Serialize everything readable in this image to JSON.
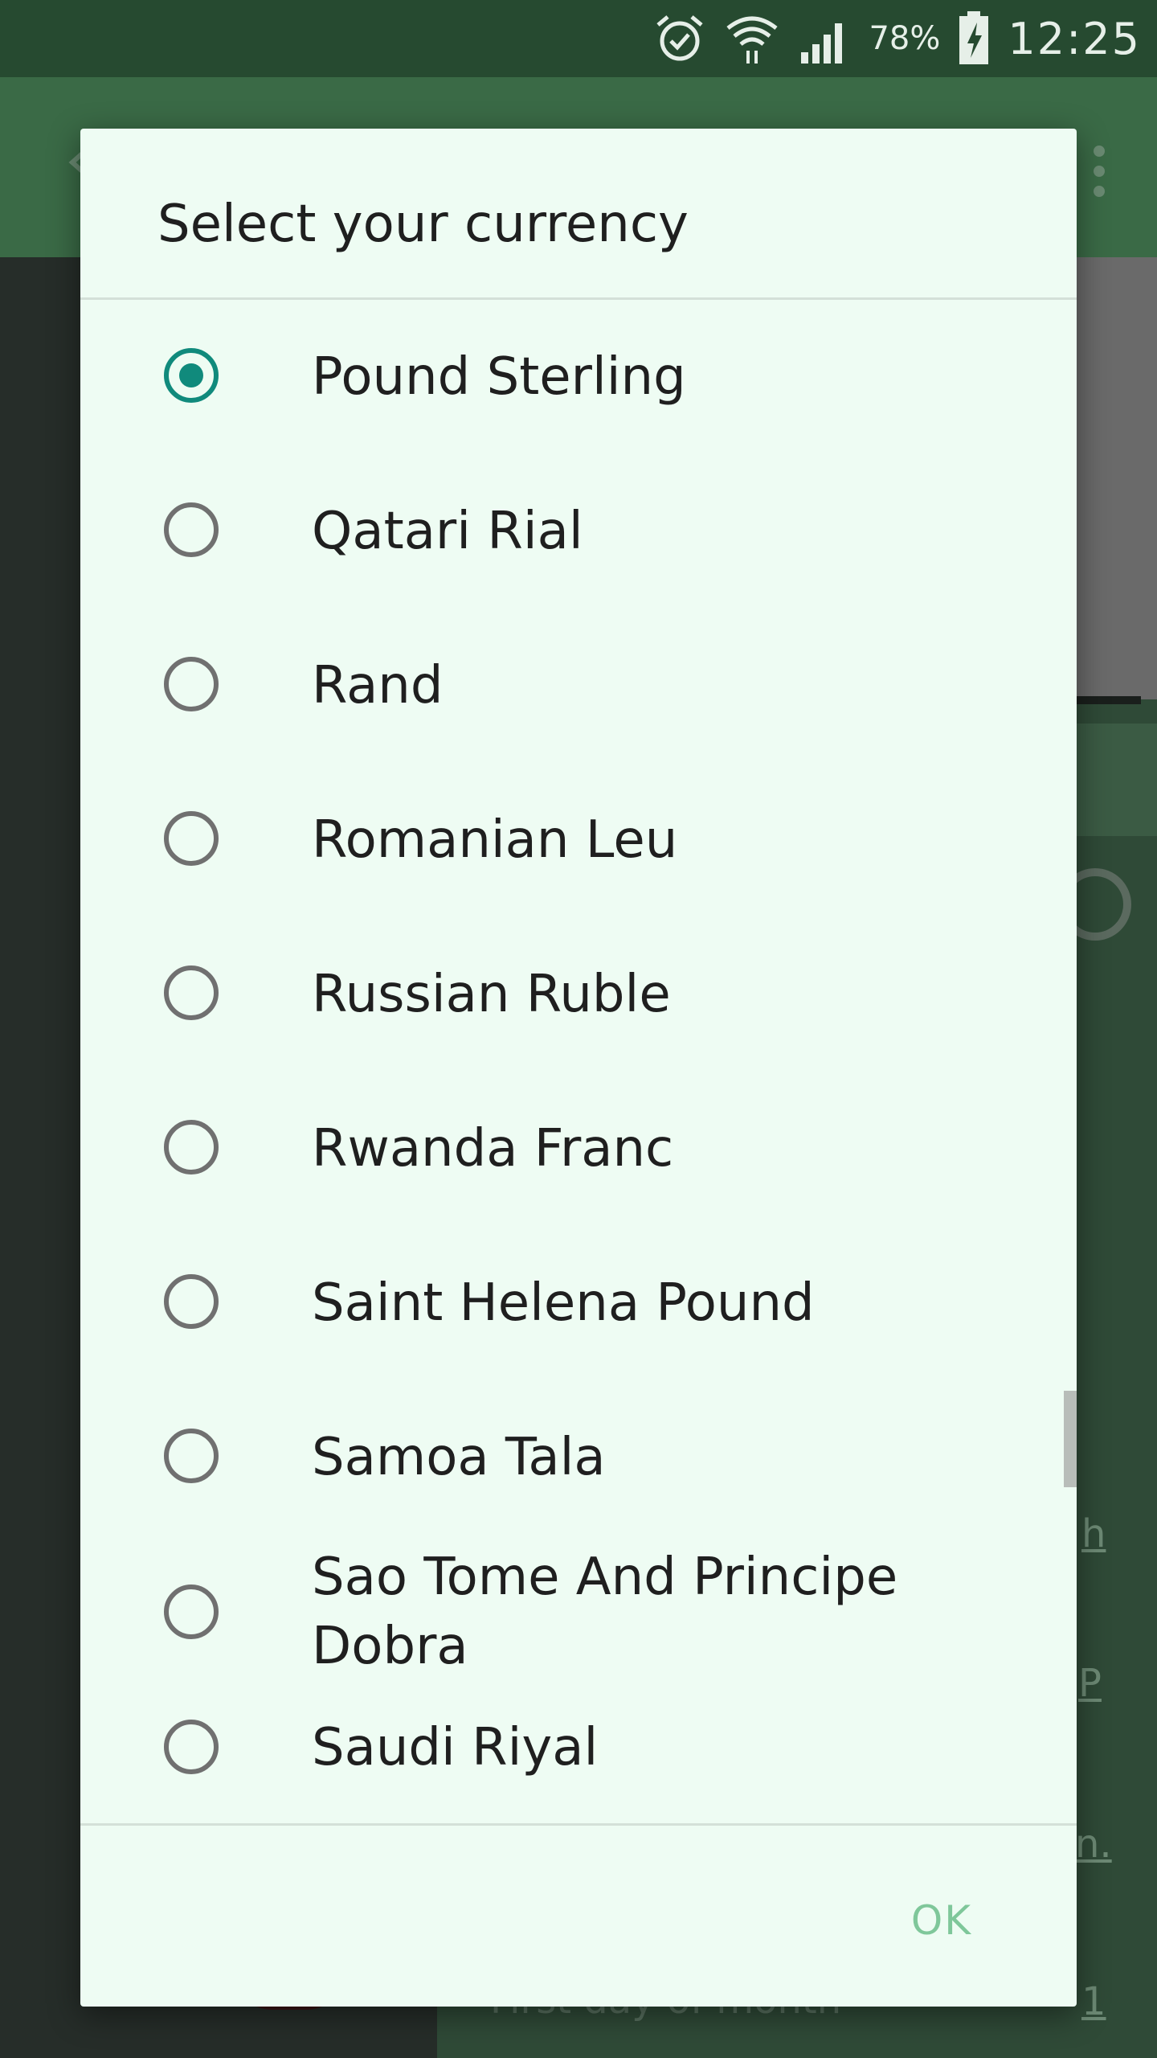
{
  "status_bar": {
    "battery_percent": "78%",
    "time": "12:25",
    "icons": [
      "alarm-icon",
      "wifi-icon",
      "signal-icon",
      "battery-charging-icon"
    ]
  },
  "background": {
    "link_fragments": [
      "h",
      "P",
      "n.",
      "1"
    ],
    "bottom_text": "First day of month"
  },
  "dialog": {
    "title": "Select your currency",
    "selected_index": 0,
    "items": [
      {
        "label": "Pound Sterling"
      },
      {
        "label": "Qatari Rial"
      },
      {
        "label": "Rand"
      },
      {
        "label": "Romanian Leu"
      },
      {
        "label": "Russian Ruble"
      },
      {
        "label": "Rwanda Franc"
      },
      {
        "label": "Saint Helena Pound"
      },
      {
        "label": "Samoa Tala"
      },
      {
        "label": "Sao Tome And Principe Dobra"
      },
      {
        "label": "Saudi Riyal"
      }
    ],
    "ok_label": "OK"
  },
  "colors": {
    "accent": "#108a7c",
    "ok_text": "#7fc79a",
    "dialog_bg": "#eefcf3",
    "status_bar": "#264a30",
    "app_bar": "#3a6a46"
  }
}
